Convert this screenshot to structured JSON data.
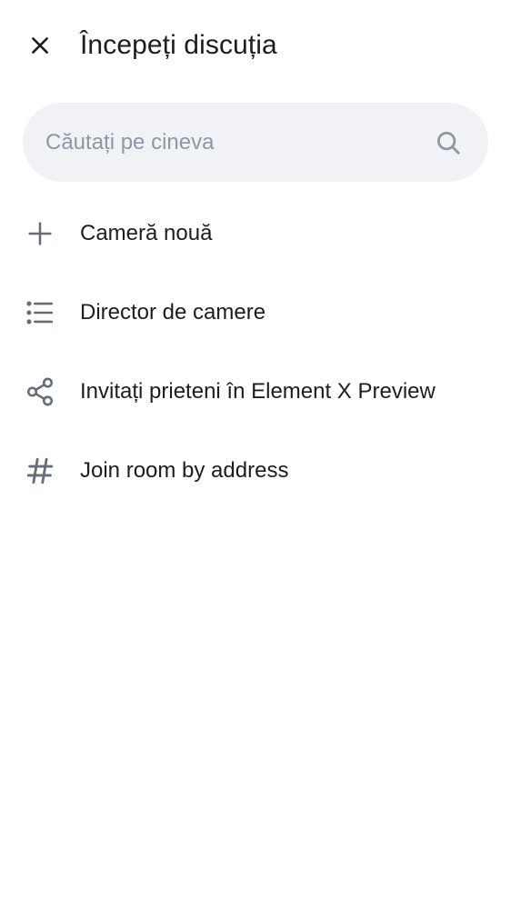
{
  "header": {
    "title": "Începeți discuția",
    "close_icon": "close-icon"
  },
  "search": {
    "placeholder": "Căutați pe cineva",
    "value": "",
    "icon": "search-icon"
  },
  "menu": {
    "items": [
      {
        "label": "Cameră nouă",
        "icon": "plus-icon"
      },
      {
        "label": "Director de camere",
        "icon": "list-icon"
      },
      {
        "label": "Invitați prieteni în Element X Preview",
        "icon": "share-icon"
      },
      {
        "label": "Join room by address",
        "icon": "hash-icon"
      }
    ]
  },
  "colors": {
    "background": "#ffffff",
    "text_primary": "#1b1d22",
    "icon": "#656d77",
    "search_background": "#f0f2f5",
    "placeholder": "#8d97a5"
  }
}
